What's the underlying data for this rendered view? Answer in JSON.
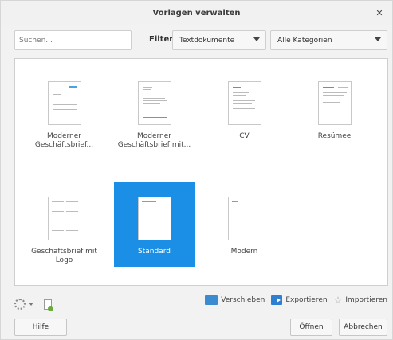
{
  "window": {
    "title": "Vorlagen verwalten",
    "close_icon": "close-icon"
  },
  "search": {
    "placeholder": "Suchen..."
  },
  "filter": {
    "label": "Filter",
    "type_selected": "Textdokumente",
    "category_selected": "Alle Kategorien"
  },
  "templates": [
    {
      "label": "Moderner Geschäftsbrief...",
      "selected": false
    },
    {
      "label": "Moderner Geschäftsbrief mit...",
      "selected": false
    },
    {
      "label": "CV",
      "selected": false
    },
    {
      "label": "Resümee",
      "selected": false
    },
    {
      "label": "Geschäftsbrief mit Logo",
      "selected": false
    },
    {
      "label": "Standard",
      "selected": true
    },
    {
      "label": "Modern",
      "selected": false
    }
  ],
  "actions": {
    "move": "Verschieben",
    "export": "Exportieren",
    "import": "Importieren"
  },
  "buttons": {
    "help": "Hilfe",
    "open": "Öffnen",
    "cancel": "Abbrechen"
  },
  "colors": {
    "selection": "#1b8ee6",
    "accent": "#2e7fd1"
  }
}
